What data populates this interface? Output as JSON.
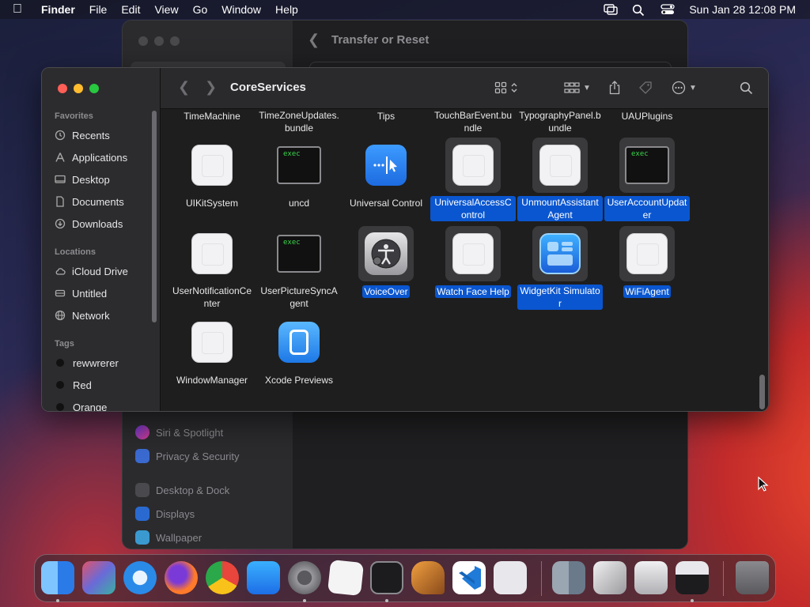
{
  "menubar": {
    "app": "Finder",
    "menus": [
      "File",
      "Edit",
      "View",
      "Go",
      "Window",
      "Help"
    ],
    "clock": "Sun Jan 28  12:08 PM"
  },
  "settings": {
    "title": "Transfer or Reset",
    "items": [
      "Siri & Spotlight",
      "Privacy & Security",
      "Desktop & Dock",
      "Displays",
      "Wallpaper"
    ]
  },
  "finder": {
    "title": "CoreServices",
    "sidebar": {
      "favorites_header": "Favorites",
      "favorites": [
        "Recents",
        "Applications",
        "Desktop",
        "Documents",
        "Downloads"
      ],
      "locations_header": "Locations",
      "locations": [
        "iCloud Drive",
        "Untitled",
        "Network"
      ],
      "tags_header": "Tags",
      "tags": [
        {
          "label": "rewwrerer",
          "color": "#1a1a1a"
        },
        {
          "label": "Red",
          "color": "#1a1a1a"
        },
        {
          "label": "Orange",
          "color": "#1a1a1a"
        }
      ]
    },
    "top_row": [
      "TimeMachine",
      "TimeZoneUpdates.bundle",
      "Tips",
      "TouchBarEvent.bundle",
      "TypographyPanel.bundle",
      "UAUPlugins"
    ],
    "items": [
      {
        "label": "UIKitSystem",
        "icon": "generic",
        "selected": false
      },
      {
        "label": "uncd",
        "icon": "exec",
        "selected": false
      },
      {
        "label": "Universal Control",
        "icon": "universal-control",
        "selected": false
      },
      {
        "label": "UniversalAccessControl",
        "icon": "generic",
        "selected": true
      },
      {
        "label": "UnmountAssistantAgent",
        "icon": "generic",
        "selected": true
      },
      {
        "label": "UserAccountUpdater",
        "icon": "exec",
        "selected": true
      },
      {
        "label": "UserNotificationCenter",
        "icon": "generic",
        "selected": false
      },
      {
        "label": "UserPictureSyncAgent",
        "icon": "exec",
        "selected": false
      },
      {
        "label": "VoiceOver",
        "icon": "voiceover",
        "selected": true
      },
      {
        "label": "Watch Face Help",
        "icon": "generic",
        "selected": true
      },
      {
        "label": "WidgetKit Simulator",
        "icon": "widgetkit",
        "selected": true
      },
      {
        "label": "WiFiAgent",
        "icon": "generic",
        "selected": true
      },
      {
        "label": "WindowManager",
        "icon": "generic",
        "selected": false
      },
      {
        "label": "Xcode Previews",
        "icon": "xcode-previews",
        "selected": false
      }
    ],
    "exec_text": "exec"
  },
  "dock": {
    "apps": [
      "finder",
      "launchpad",
      "safari",
      "firefox",
      "chrome",
      "app-store",
      "system-settings",
      "textedit",
      "terminal",
      "garageband",
      "vscode",
      "blank-app",
      "finder-doc",
      "disk-utility",
      "system-info",
      "bartender"
    ],
    "colors": [
      "#3a8ef0",
      "#7a6a9a",
      "#2a8ae8",
      "#ff7a2a",
      "#e8e8e8",
      "#1d8cf0",
      "#8a8a8e",
      "#f2f2f2",
      "#222222",
      "#b87a3a",
      "#1f7ad8",
      "#e8e8ec",
      "#6a7a8a",
      "#c8c8cc",
      "#d8d8dc",
      "#3a3a3e"
    ]
  }
}
